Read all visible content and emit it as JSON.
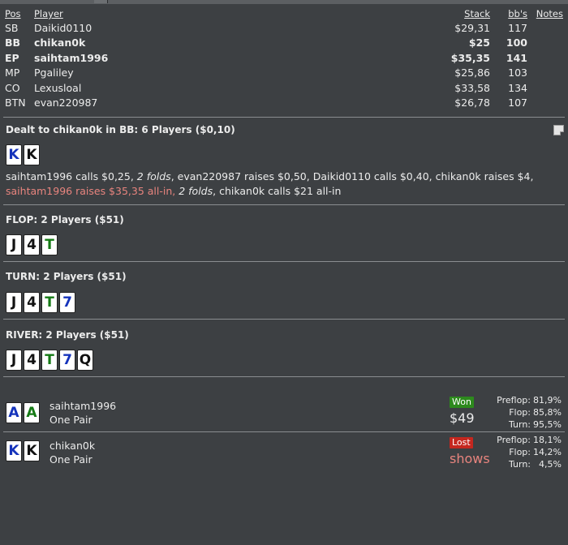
{
  "players_table": {
    "headers": {
      "pos": "Pos",
      "player": "Player",
      "stack": "Stack",
      "bbs": "bb's",
      "notes": "Notes"
    },
    "rows": [
      {
        "pos": "SB",
        "player": "Daikid0110",
        "stack": "$29,31",
        "bbs": "117",
        "bold": false
      },
      {
        "pos": "BB",
        "player": "chikan0k",
        "stack": "$25",
        "bbs": "100",
        "bold": true
      },
      {
        "pos": "EP",
        "player": "saihtam1996",
        "stack": "$35,35",
        "bbs": "141",
        "bold": true
      },
      {
        "pos": "MP",
        "player": "Pgaliley",
        "stack": "$25,86",
        "bbs": "103",
        "bold": false
      },
      {
        "pos": "CO",
        "player": "Lexusloal",
        "stack": "$33,58",
        "bbs": "134",
        "bold": false
      },
      {
        "pos": "BTN",
        "player": "evan220987",
        "stack": "$26,78",
        "bbs": "107",
        "bold": false
      }
    ]
  },
  "preflop": {
    "title": "Dealt to chikan0k in BB: 6 Players ($0,10)",
    "cards": [
      {
        "rank": "K",
        "suit": "d"
      },
      {
        "rank": "K",
        "suit": "s"
      }
    ],
    "action_a": "saihtam1996 calls $0,25, ",
    "action_b": "2 folds",
    "action_c": ", evan220987 raises $0,50, Daikid0110 calls $0,40, chikan0k raises $4, ",
    "action_d": "saihtam1996 raises $35,35 all-in,",
    "action_e": " ",
    "action_f": "2 folds",
    "action_g": ", chikan0k calls $21 all-in"
  },
  "flop": {
    "title": "FLOP: 2 Players ($51)",
    "cards": [
      {
        "rank": "J",
        "suit": "s"
      },
      {
        "rank": "4",
        "suit": "s"
      },
      {
        "rank": "T",
        "suit": "c"
      }
    ]
  },
  "turn": {
    "title": "TURN: 2 Players ($51)",
    "cards": [
      {
        "rank": "J",
        "suit": "s"
      },
      {
        "rank": "4",
        "suit": "s"
      },
      {
        "rank": "T",
        "suit": "c"
      },
      {
        "rank": "7",
        "suit": "d"
      }
    ]
  },
  "river": {
    "title": "RIVER: 2 Players ($51)",
    "cards": [
      {
        "rank": "J",
        "suit": "s"
      },
      {
        "rank": "4",
        "suit": "s"
      },
      {
        "rank": "T",
        "suit": "c"
      },
      {
        "rank": "7",
        "suit": "d"
      },
      {
        "rank": "Q",
        "suit": "s"
      }
    ]
  },
  "results": [
    {
      "name": "saihtam1996",
      "hand": "One Pair",
      "cards": [
        {
          "rank": "A",
          "suit": "d"
        },
        {
          "rank": "A",
          "suit": "c"
        }
      ],
      "status": "Won",
      "amount": "$49",
      "equity": [
        {
          "label": "Preflop:",
          "value": "81,9%"
        },
        {
          "label": "Flop:",
          "value": "85,8%"
        },
        {
          "label": "Turn:",
          "value": "95,5%"
        }
      ]
    },
    {
      "name": "chikan0k",
      "hand": "One Pair",
      "cards": [
        {
          "rank": "K",
          "suit": "d"
        },
        {
          "rank": "K",
          "suit": "s"
        }
      ],
      "status": "Lost",
      "amount": "shows",
      "equity": [
        {
          "label": "Preflop:",
          "value": "18,1%"
        },
        {
          "label": "Flop:",
          "value": "14,2%"
        },
        {
          "label": "Turn:",
          "value": "4,5%"
        }
      ]
    }
  ],
  "colors": {
    "background": "#3d4043",
    "text": "#ececec",
    "allin_red": "#e8847e",
    "won_green": "#2d8a1d",
    "lost_red": "#c4271f"
  }
}
